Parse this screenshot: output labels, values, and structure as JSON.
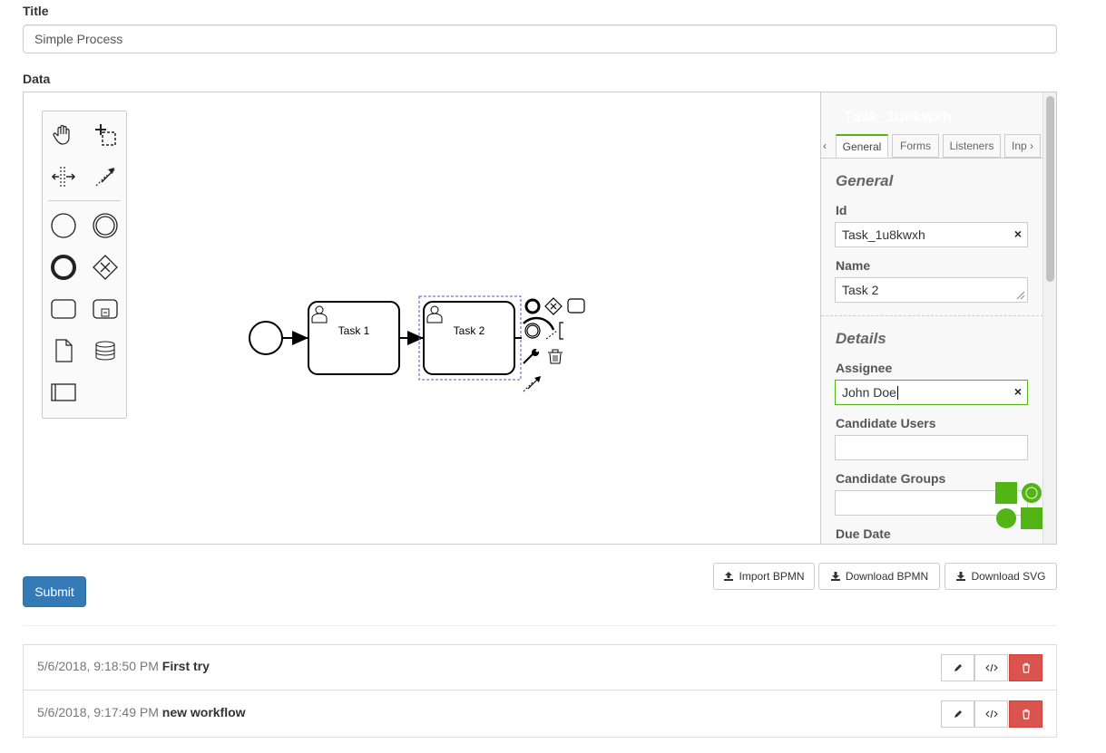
{
  "form": {
    "title_label": "Title",
    "title_value": "Simple Process",
    "data_label": "Data"
  },
  "palette": {
    "tools": [
      "hand-tool",
      "lasso-tool",
      "space-tool",
      "connect-tool"
    ],
    "shapes": [
      "start-event",
      "intermediate-event",
      "end-event",
      "gateway",
      "task",
      "subprocess",
      "data-object",
      "data-store",
      "pool"
    ]
  },
  "diagram": {
    "task1_label": "Task 1",
    "task2_label": "Task 2"
  },
  "properties": {
    "header": "Task_1u8kwxh",
    "tabs": [
      "General",
      "Forms",
      "Listeners",
      "Inp"
    ],
    "active_tab": "General",
    "general_title": "General",
    "id_label": "Id",
    "id_value": "Task_1u8kwxh",
    "name_label": "Name",
    "name_value": "Task 2",
    "details_title": "Details",
    "assignee_label": "Assignee",
    "assignee_value": "John Doe",
    "candidate_users_label": "Candidate Users",
    "candidate_users_value": "",
    "candidate_groups_label": "Candidate Groups",
    "candidate_groups_value": "",
    "due_date_label": "Due Date"
  },
  "actions": {
    "submit": "Submit",
    "import_bpmn": "Import BPMN",
    "download_bpmn": "Download BPMN",
    "download_svg": "Download SVG"
  },
  "history": [
    {
      "timestamp": "5/6/2018, 9:18:50 PM",
      "name": "First try"
    },
    {
      "timestamp": "5/6/2018, 9:17:49 PM",
      "name": "new workflow"
    }
  ],
  "colors": {
    "accent_green": "#52b415",
    "primary_blue": "#337ab7",
    "danger_red": "#d9534f"
  }
}
